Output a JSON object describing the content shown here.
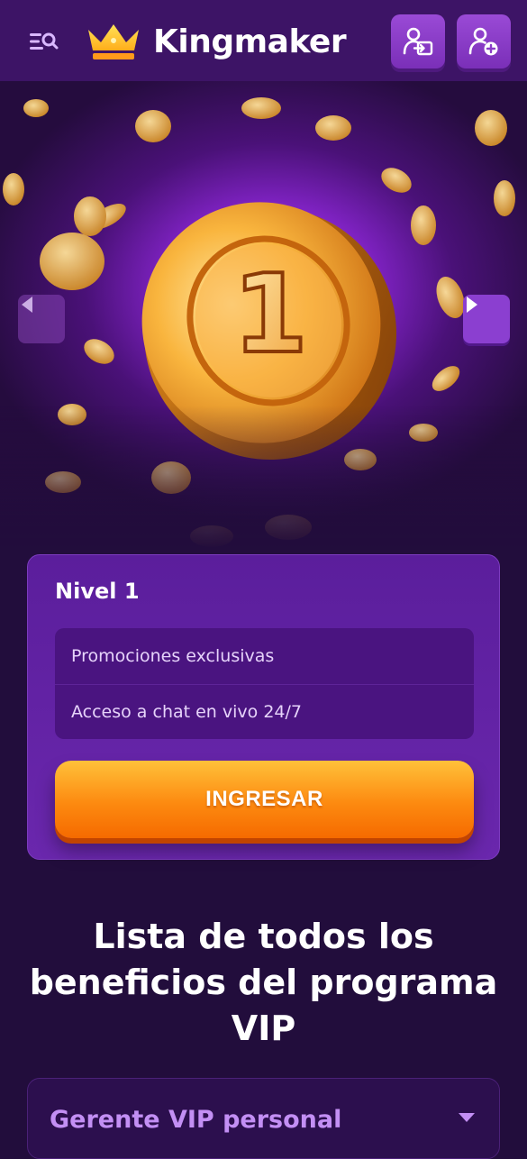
{
  "header": {
    "brand": "Kingmaker",
    "icons": {
      "menu": "menu-search-icon",
      "logo": "crown-icon",
      "login": "user-login-icon",
      "register": "user-add-icon"
    }
  },
  "hero": {
    "image": "golden-coin-number-1",
    "coin_number": "1",
    "icons": {
      "prev": "chevron-left-icon",
      "next": "chevron-right-icon"
    }
  },
  "level_card": {
    "title": "Nivel 1",
    "benefits": [
      "Promociones exclusivas",
      "Acceso a chat en vivo 24/7"
    ],
    "cta_label": "INGRESAR"
  },
  "section": {
    "title": "Lista de todos los beneficios del programa VIP"
  },
  "accordion": {
    "first_label": "Gerente VIP personal",
    "icon": "chevron-down-icon"
  },
  "colors": {
    "background": "#220d3c",
    "header": "#3d1466",
    "card": "#5b1e9c",
    "cta": "#fd8a10",
    "accent_text": "#c38ff4"
  }
}
